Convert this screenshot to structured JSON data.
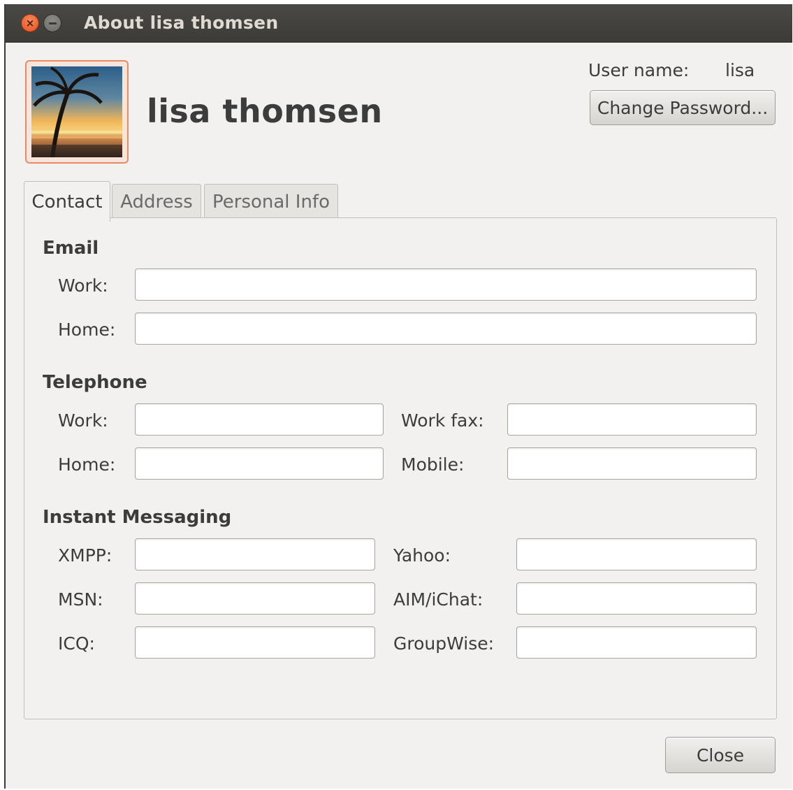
{
  "window": {
    "title": "About lisa thomsen",
    "close_glyph": "×"
  },
  "header": {
    "full_name": "lisa thomsen",
    "user_name_label": "User name:",
    "user_name_value": "lisa",
    "change_password_label": "Change Password..."
  },
  "tabs": [
    {
      "label": "Contact",
      "active": true
    },
    {
      "label": "Address",
      "active": false
    },
    {
      "label": "Personal Info",
      "active": false
    }
  ],
  "contact": {
    "email": {
      "heading": "Email",
      "work_label": "Work:",
      "work_value": "",
      "home_label": "Home:",
      "home_value": ""
    },
    "telephone": {
      "heading": "Telephone",
      "work_label": "Work:",
      "work_value": "",
      "home_label": "Home:",
      "home_value": "",
      "work_fax_label": "Work fax:",
      "work_fax_value": "",
      "mobile_label": "Mobile:",
      "mobile_value": ""
    },
    "im": {
      "heading": "Instant Messaging",
      "xmpp_label": "XMPP:",
      "xmpp_value": "",
      "msn_label": "MSN:",
      "msn_value": "",
      "icq_label": "ICQ:",
      "icq_value": "",
      "yahoo_label": "Yahoo:",
      "yahoo_value": "",
      "aim_label": "AIM/iChat:",
      "aim_value": "",
      "groupwise_label": "GroupWise:",
      "groupwise_value": ""
    }
  },
  "footer": {
    "close_label": "Close"
  },
  "colors": {
    "window_bg": "#f2f1f0",
    "titlebar_bg": "#3c3b37",
    "close_button": "#e2501f",
    "avatar_border": "#e88a6a"
  },
  "icons": {
    "window_close": "close-icon",
    "window_minimize": "minimize-icon",
    "avatar": "palm-sunset-avatar"
  }
}
